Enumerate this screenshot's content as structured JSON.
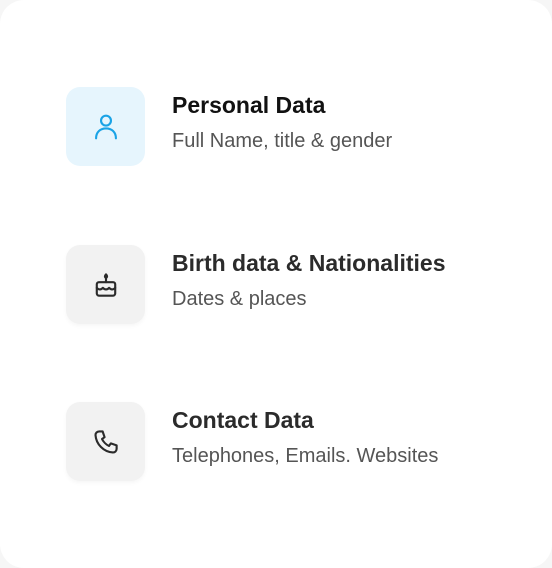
{
  "menu": {
    "items": [
      {
        "title": "Personal Data",
        "subtitle": "Full Name, title & gender",
        "icon": "user-icon",
        "active": true,
        "icon_color": "#1aa3e6"
      },
      {
        "title": "Birth data & Nationalities",
        "subtitle": "Dates & places",
        "icon": "birthday-cake-icon",
        "active": false,
        "icon_color": "#2b2b2b"
      },
      {
        "title": "Contact Data",
        "subtitle": "Telephones, Emails. Websites",
        "icon": "phone-icon",
        "active": false,
        "icon_color": "#2b2b2b"
      }
    ]
  }
}
